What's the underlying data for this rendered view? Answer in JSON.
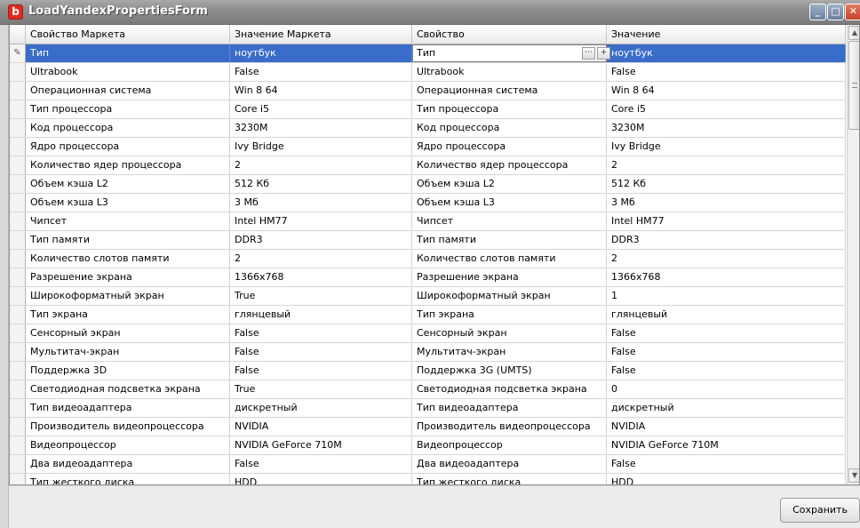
{
  "window": {
    "title": "LoadYandexPropertiesForm",
    "icon_letter": "b",
    "minimize_glyph": "_",
    "maximize_glyph": "□",
    "close_glyph": "✕"
  },
  "grid": {
    "columns": [
      "Свойство Маркета",
      "Значение Маркета",
      "Свойство",
      "Значение"
    ],
    "selected_row_index": 0,
    "editing_value": "Тип",
    "rows": [
      [
        "Тип",
        "ноутбук",
        "Тип",
        "ноутбук"
      ],
      [
        "Ultrabook",
        "False",
        "Ultrabook",
        "False"
      ],
      [
        "Операционная система",
        "Win 8 64",
        "Операционная система",
        "Win 8 64"
      ],
      [
        "Тип процессора",
        "Core i5",
        "Тип процессора",
        "Core i5"
      ],
      [
        "Код процессора",
        "3230M",
        "Код процессора",
        "3230M"
      ],
      [
        "Ядро процессора",
        "Ivy Bridge",
        "Ядро процессора",
        "Ivy Bridge"
      ],
      [
        "Количество ядер процессора",
        "2",
        "Количество ядер процессора",
        "2"
      ],
      [
        "Объем кэша L2",
        "512 Кб",
        "Объем кэша L2",
        "512 Кб"
      ],
      [
        "Объем кэша L3",
        "3 Мб",
        "Объем кэша L3",
        "3 Мб"
      ],
      [
        "Чипсет",
        "Intel HM77",
        "Чипсет",
        "Intel HM77"
      ],
      [
        "Тип памяти",
        "DDR3",
        "Тип памяти",
        "DDR3"
      ],
      [
        "Количество слотов памяти",
        "2",
        "Количество слотов памяти",
        "2"
      ],
      [
        "Разрешение экрана",
        "1366x768",
        "Разрешение экрана",
        "1366x768"
      ],
      [
        "Широкоформатный экран",
        "True",
        "Широкоформатный экран",
        "1"
      ],
      [
        "Тип экрана",
        "глянцевый",
        "Тип экрана",
        "глянцевый"
      ],
      [
        "Сенсорный экран",
        "False",
        "Сенсорный экран",
        "False"
      ],
      [
        "Мультитач-экран",
        "False",
        "Мультитач-экран",
        "False"
      ],
      [
        "Поддержка 3D",
        "False",
        "Поддержка 3G (UMTS)",
        "False"
      ],
      [
        "Светодиодная подсветка экрана",
        "True",
        "Светодиодная подсветка экрана",
        "0"
      ],
      [
        "Тип видеоадаптера",
        "дискретный",
        "Тип видеоадаптера",
        "дискретный"
      ],
      [
        "Производитель видеопроцессора",
        "NVIDIA",
        "Производитель видеопроцессора",
        "NVIDIA"
      ],
      [
        "Видеопроцессор",
        "NVIDIA GeForce 710M",
        "Видеопроцессор",
        "NVIDIA GeForce 710M"
      ],
      [
        "Два видеоадаптера",
        "False",
        "Два видеоадаптера",
        "False"
      ],
      [
        "Тип жесткого диска",
        "HDD",
        "Тип жесткого диска",
        "HDD"
      ]
    ]
  },
  "footer": {
    "save_label": "Сохранить"
  }
}
